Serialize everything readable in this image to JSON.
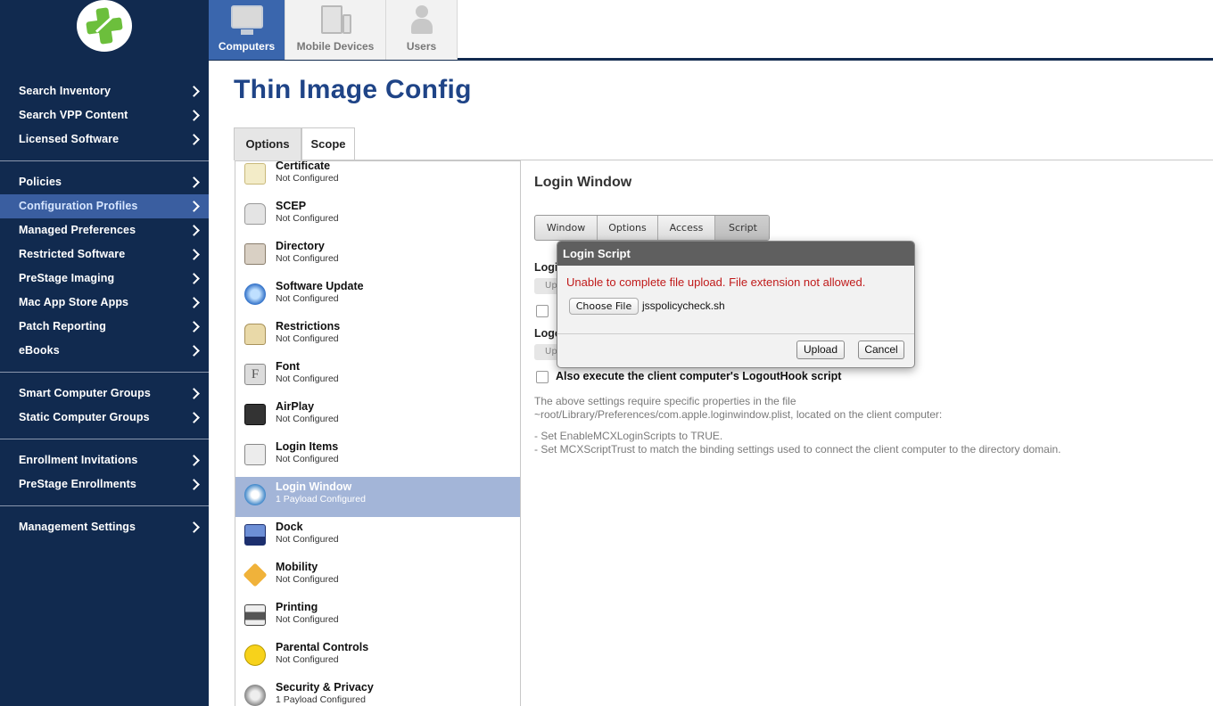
{
  "colors": {
    "sidebar_bg": "#112a4f",
    "active_nav": "#3a5ea0",
    "top_active_tab": "#3a66ad",
    "title": "#1f4487",
    "selected_payload": "#a3b5d8",
    "error_text": "#c01a1a",
    "logo_green": "#6cbf3c"
  },
  "sidebar": {
    "logo_icon": "jamf-cross-icon",
    "groups": [
      {
        "items": [
          "Search Inventory",
          "Search VPP Content",
          "Licensed Software"
        ]
      },
      {
        "items": [
          "Policies",
          "Configuration Profiles",
          "Managed Preferences",
          "Restricted Software",
          "PreStage Imaging",
          "Mac App Store Apps",
          "Patch Reporting",
          "eBooks"
        ]
      },
      {
        "items": [
          "Smart Computer Groups",
          "Static Computer Groups"
        ]
      },
      {
        "items": [
          "Enrollment Invitations",
          "PreStage Enrollments"
        ]
      },
      {
        "items": [
          "Management Settings"
        ]
      }
    ],
    "active_item": "Configuration Profiles"
  },
  "top_tabs": [
    {
      "label": "Computers",
      "icon": "computer-icon",
      "active": true
    },
    {
      "label": "Mobile Devices",
      "icon": "mobile-devices-icon",
      "active": false
    },
    {
      "label": "Users",
      "icon": "user-icon",
      "active": false
    }
  ],
  "page_title": "Thin Image Config",
  "sub_tabs": [
    "Options",
    "Scope"
  ],
  "payloads": [
    {
      "name": "Certificate",
      "status": "Not Configured",
      "icon": "certificate-icon"
    },
    {
      "name": "SCEP",
      "status": "Not Configured",
      "icon": "scep-lock-icon"
    },
    {
      "name": "Directory",
      "status": "Not Configured",
      "icon": "directory-icon"
    },
    {
      "name": "Software Update",
      "status": "Not Configured",
      "icon": "software-update-icon"
    },
    {
      "name": "Restrictions",
      "status": "Not Configured",
      "icon": "restrictions-lock-icon"
    },
    {
      "name": "Font",
      "status": "Not Configured",
      "icon": "font-icon"
    },
    {
      "name": "AirPlay",
      "status": "Not Configured",
      "icon": "airplay-icon"
    },
    {
      "name": "Login Items",
      "status": "Not Configured",
      "icon": "login-items-icon"
    },
    {
      "name": "Login Window",
      "status": "1 Payload Configured",
      "icon": "login-window-icon",
      "selected": true
    },
    {
      "name": "Dock",
      "status": "Not Configured",
      "icon": "dock-icon"
    },
    {
      "name": "Mobility",
      "status": "Not Configured",
      "icon": "mobility-icon"
    },
    {
      "name": "Printing",
      "status": "Not Configured",
      "icon": "printer-icon"
    },
    {
      "name": "Parental Controls",
      "status": "Not Configured",
      "icon": "parental-controls-icon"
    },
    {
      "name": "Security & Privacy",
      "status": "1 Payload Configured",
      "icon": "security-privacy-icon"
    }
  ],
  "detail": {
    "title": "Login Window",
    "segments": [
      "Window",
      "Options",
      "Access",
      "Script"
    ],
    "active_segment": "Script",
    "partial_login_label": "Logi",
    "partial_logout_label": "Logo",
    "partial_upload": "Up",
    "also_execute": "Also execute the client computer's LogoutHook script",
    "note_line1": "The above settings require specific properties in the file",
    "note_line2": "~root/Library/Preferences/com.apple.loginwindow.plist, located on the client computer:",
    "note_line3": "- Set EnableMCXLoginScripts to TRUE.",
    "note_line4": "- Set MCXScriptTrust to match the binding settings used to connect the client computer to the directory domain."
  },
  "modal": {
    "title": "Login Script",
    "error": "Unable to complete file upload. File extension not allowed.",
    "choose_file": "Choose File",
    "file_name": "jsspolicycheck.sh",
    "upload": "Upload",
    "cancel": "Cancel"
  }
}
